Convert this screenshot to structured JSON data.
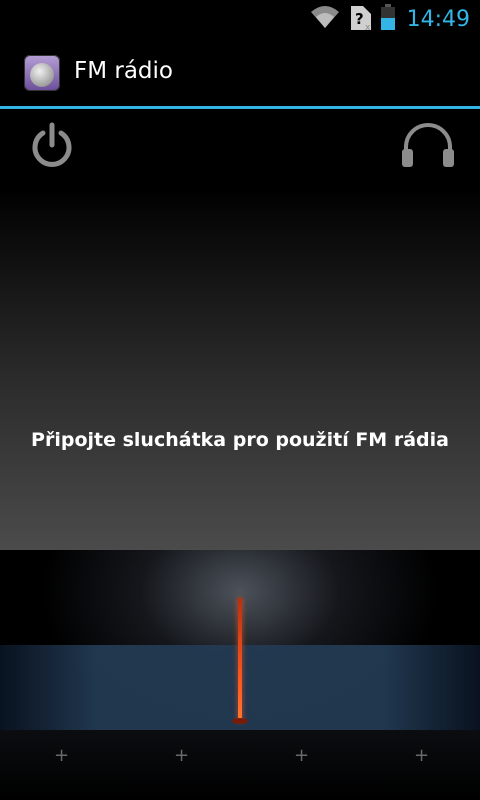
{
  "status_bar": {
    "time": "14:49",
    "icons": [
      "wifi-icon",
      "no-sim-icon",
      "battery-icon"
    ],
    "accent_color": "#33b5e5"
  },
  "action_bar": {
    "title": "FM rádio",
    "app_icon": "fm-radio-app-icon"
  },
  "controls": {
    "power_icon": "power-icon",
    "headset_icon": "headphones-icon"
  },
  "message": "Připojte sluchátka pro použití FM rádia",
  "tuner": {
    "needle_color": "#ff5a20",
    "tick_marks": [
      "+",
      "+",
      "+",
      "+"
    ]
  }
}
